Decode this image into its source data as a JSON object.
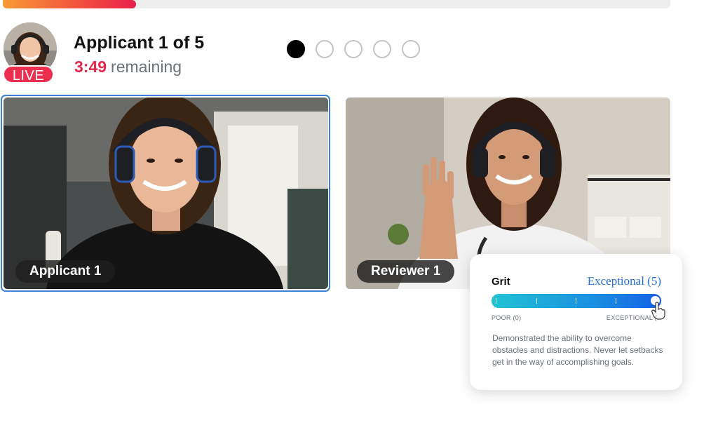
{
  "progress": {
    "fraction": 0.2,
    "colors": [
      "#f89b35",
      "#e8214a"
    ]
  },
  "header": {
    "title": "Applicant 1 of 5",
    "timer": "3:49",
    "remaining_label": "remaining",
    "live_badge": "LIVE",
    "live_color": "#ee2e4f"
  },
  "steps": {
    "total": 5,
    "current": 1
  },
  "tiles": {
    "applicant_label": "Applicant 1",
    "reviewer_label": "Reviewer 1",
    "active_border_color": "#3b82d6"
  },
  "score_card": {
    "label": "Grit",
    "rating": "Exceptional (5)",
    "rating_color": "#1e6fd9",
    "scale_min": "POOR (0)",
    "scale_max": "EXCEPTIONAL (",
    "value": 5,
    "max": 5,
    "description": "Demonstrated the ability to overcome obstacles and distractions. Never let setbacks get in the way of accomplishing goals."
  },
  "icons": {
    "pointer": "hand-pointer-icon"
  }
}
